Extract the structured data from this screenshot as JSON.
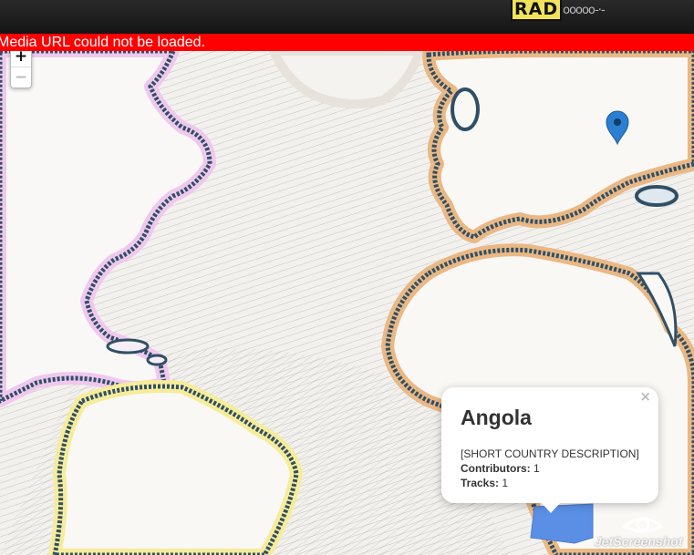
{
  "header": {
    "logo_text": "RAD",
    "logo_tail": "ooooo-·-"
  },
  "error": {
    "message": "Media URL could not be loaded."
  },
  "map": {
    "zoom_in_label": "+",
    "zoom_out_label": "−",
    "marker_color": "#2a7fd0",
    "selected_country_color": "#5b8fe6"
  },
  "popup": {
    "title": "Angola",
    "description": "[SHORT COUNTRY DESCRIPTION]",
    "contributors_label": "Contributors:",
    "contributors_value": "1",
    "tracks_label": "Tracks:",
    "tracks_value": "1",
    "close_label": "×"
  },
  "watermark": {
    "text": "JetScreenshot"
  }
}
